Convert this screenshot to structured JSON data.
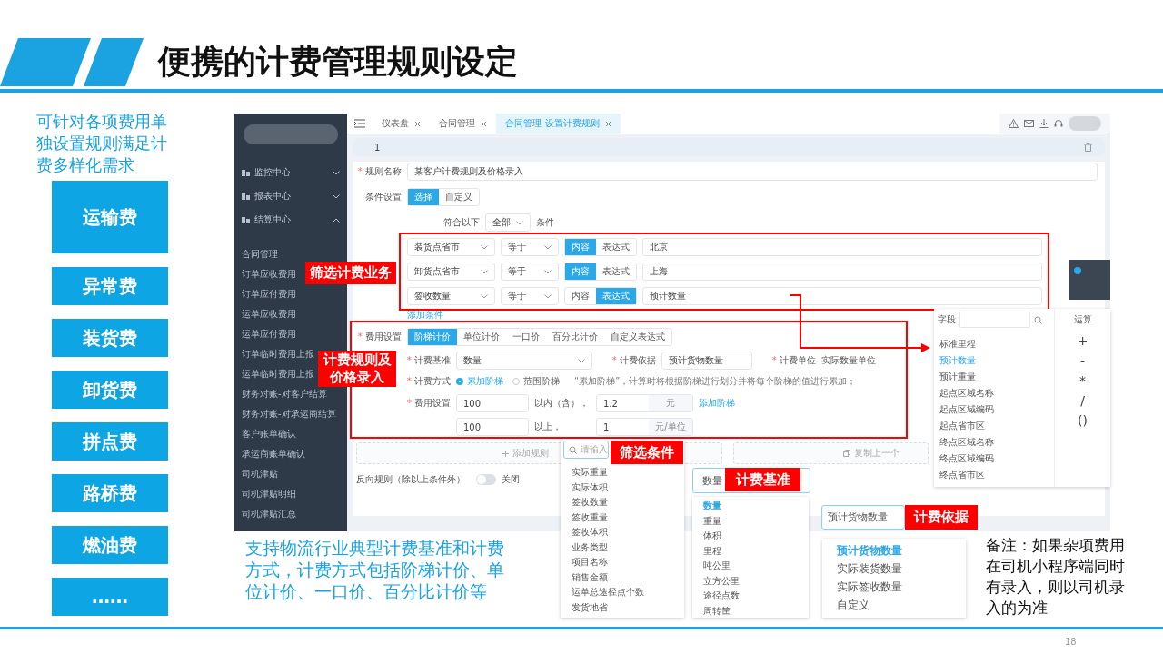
{
  "slide": {
    "title": "便携的计费管理规则设定",
    "description": "可针对各项费用单独设置规则满足计费多样化需求",
    "fee_types": [
      "运输费",
      "异常费",
      "装货费",
      "卸货费",
      "拼点费",
      "路桥费",
      "燃油费",
      "……"
    ],
    "caption": "支持物流行业典型计费基准和计费方式，计费方式包括阶梯计价、单位计价、一口价、百分比计价等",
    "note": "备注：如果杂项费用在司机小程序端同时有录入，则以司机录入的为准",
    "page_number": "18"
  },
  "app": {
    "sidebar": {
      "groups": [
        {
          "label": "监控中心",
          "expanded": false
        },
        {
          "label": "报表中心",
          "expanded": false
        },
        {
          "label": "结算中心",
          "expanded": true,
          "children": [
            "合同管理",
            "订单应收费用",
            "订单应付费用",
            "运单应收费用",
            "运单应付费用",
            "订单临时费用上报",
            "运单临时费用上报",
            "财务对账-对客户结算",
            "财务对账-对承运商结算",
            "客户账单确认",
            "承运商账单确认",
            "司机津贴",
            "司机津贴明细",
            "司机津贴汇总"
          ]
        }
      ]
    },
    "tabs": [
      {
        "label": "仪表盘",
        "selected": false
      },
      {
        "label": "合同管理",
        "selected": false
      },
      {
        "label": "合同管理-设置计费规则",
        "selected": true
      }
    ],
    "rule_index": "1",
    "rule_name": {
      "label": "规则名称",
      "value": "某客户计费规则及价格录入"
    },
    "condition_mode": {
      "label": "条件设置",
      "options": [
        {
          "label": "选择",
          "selected": true
        },
        {
          "label": "自定义",
          "selected": false
        }
      ]
    },
    "match": {
      "prefix": "符合以下",
      "value": "全部",
      "suffix": "条件"
    },
    "conditions": [
      {
        "field": "装货点省市",
        "operator": "等于",
        "modes": [
          {
            "label": "内容",
            "selected": true
          },
          {
            "label": "表达式",
            "selected": false
          }
        ],
        "value": "北京"
      },
      {
        "field": "卸货点省市",
        "operator": "等于",
        "modes": [
          {
            "label": "内容",
            "selected": true
          },
          {
            "label": "表达式",
            "selected": false
          }
        ],
        "value": "上海"
      },
      {
        "field": "签收数量",
        "operator": "等于",
        "modes": [
          {
            "label": "内容",
            "selected": false
          },
          {
            "label": "表达式",
            "selected": true
          }
        ],
        "value": "预计数量"
      }
    ],
    "add_condition": "添加条件",
    "pricing_mode": {
      "label": "费用设置",
      "options": [
        {
          "label": "阶梯计价",
          "selected": true
        },
        {
          "label": "单位计价",
          "selected": false
        },
        {
          "label": "一口价",
          "selected": false
        },
        {
          "label": "百分比计价",
          "selected": false
        },
        {
          "label": "自定义表达式",
          "selected": false
        }
      ]
    },
    "basis": {
      "label": "计费基准",
      "value": "数量"
    },
    "basis_by": {
      "label": "计费依据",
      "value": "预计货物数量"
    },
    "unit": {
      "label": "计费单位",
      "value": "实际数量单位"
    },
    "method": {
      "label": "计费方式",
      "options": [
        {
          "label": "累加阶梯",
          "selected": true
        },
        {
          "label": "范围阶梯",
          "selected": false
        }
      ],
      "hint": "“累加阶梯”，计算时将根据阶梯进行划分并将每个阶梯的值进行累加；"
    },
    "tiers": {
      "label": "费用设置",
      "rows": [
        {
          "amount": "100",
          "relation": "以内（含），",
          "price": "1.2",
          "unit": "元"
        },
        {
          "amount": "100",
          "relation": "以上，",
          "price": "1",
          "unit": "元/单位"
        }
      ],
      "add_tier": "添加阶梯"
    },
    "add_rule": "添加规则",
    "copy_rule": "复制上一个",
    "reverse_rule": {
      "label": "反向规则（除以上条件外）",
      "on": false,
      "state_text": "关闭"
    }
  },
  "field_picker": {
    "label": "字段",
    "operator_title": "运算",
    "items": [
      {
        "label": "标准里程",
        "selected": false
      },
      {
        "label": "预计数量",
        "selected": true
      },
      {
        "label": "预计重量",
        "selected": false
      },
      {
        "label": "起点区域名称",
        "selected": false
      },
      {
        "label": "起点区域编码",
        "selected": false
      },
      {
        "label": "起点省市区",
        "selected": false
      },
      {
        "label": "终点区域名称",
        "selected": false
      },
      {
        "label": "终点区域编码",
        "selected": false
      },
      {
        "label": "终点省市区",
        "selected": false
      }
    ],
    "operators": [
      "+",
      "-",
      "*",
      "/",
      "()"
    ]
  },
  "filter_dropdown": {
    "placeholder": "请输入",
    "items": [
      "实际重量",
      "实际体积",
      "签收数量",
      "签收重量",
      "签收体积",
      "业务类型",
      "项目名称",
      "销售金额",
      "运单总途径点个数",
      "发货地省"
    ]
  },
  "basis_dropdown": {
    "value": "数量",
    "items": [
      {
        "label": "数量",
        "selected": true
      },
      {
        "label": "重量",
        "selected": false
      },
      {
        "label": "体积",
        "selected": false
      },
      {
        "label": "里程",
        "selected": false
      },
      {
        "label": "吨公里",
        "selected": false
      },
      {
        "label": "立方公里",
        "selected": false
      },
      {
        "label": "途径点数",
        "selected": false
      },
      {
        "label": "周转筐",
        "selected": false
      }
    ]
  },
  "basis_by_dropdown": {
    "value": "预计货物数量",
    "items": [
      {
        "label": "预计货物数量",
        "selected": true
      },
      {
        "label": "实际装货数量",
        "selected": false
      },
      {
        "label": "实际签收数量",
        "selected": false
      },
      {
        "label": "自定义",
        "selected": false
      }
    ]
  },
  "callouts": [
    "筛选计费业务",
    "计费规则及价格录入",
    "筛选条件",
    "计费基准",
    "计费依据"
  ]
}
